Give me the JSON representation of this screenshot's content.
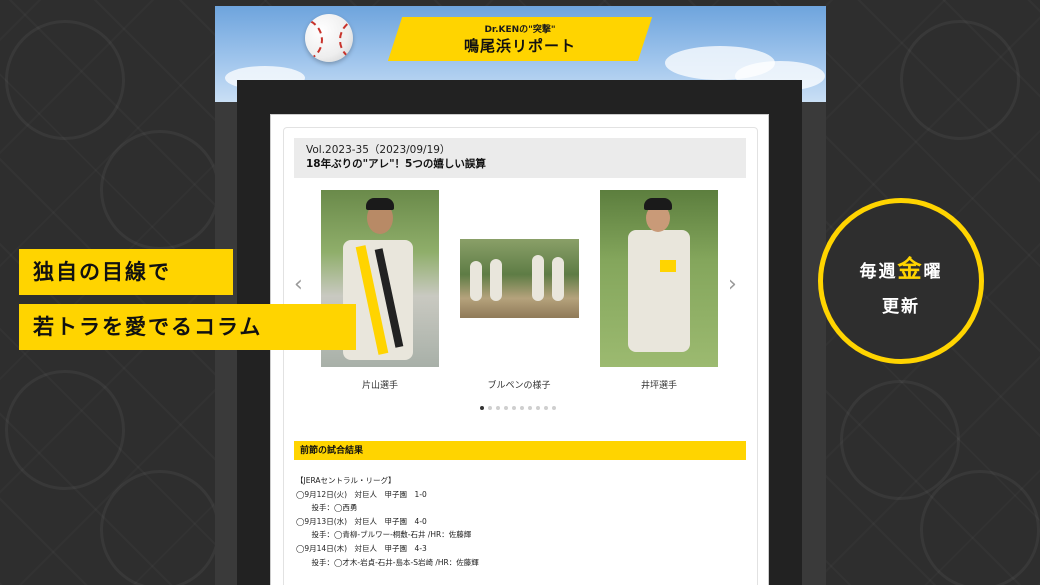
{
  "banner": {
    "subtitle": "Dr.KENの\"突撃\"",
    "title": "鳴尾浜リポート"
  },
  "article": {
    "volume": "Vol.2023-35（2023/09/19）",
    "title": "18年ぶりの\"アレ\"！5つの嬉しい誤算",
    "carousel": {
      "captions": [
        "片山選手",
        "ブルペンの様子",
        "井坪選手"
      ],
      "dot_count": 10,
      "active_dot": 0,
      "prev_icon": "chevron-left",
      "next_icon": "chevron-right"
    },
    "results_header": "前節の試合結果",
    "results": [
      "【JERAセントラル・リーグ】",
      "◯9月12日(火)　対巨人　甲子園　1-0",
      "　投手：◯西勇",
      "◯9月13日(水)　対巨人　甲子園　4-0",
      "　投手：◯青柳-ブルワー-桐敷-石井 /HR：佐藤輝",
      "◯9月14日(木)　対巨人　甲子園　4-3",
      "　投手：◯才木-岩貞-石井-島本-S岩崎 /HR：佐藤輝"
    ]
  },
  "tags": {
    "line1": "独自の目線で",
    "line2": "若トラを愛でるコラム"
  },
  "badge": {
    "pre": "毎週",
    "gold": "金",
    "post": "曜",
    "line2": "更新"
  },
  "colors": {
    "accent": "#ffd400",
    "background": "#2e2e2e",
    "sky": "#8fb8e6"
  }
}
